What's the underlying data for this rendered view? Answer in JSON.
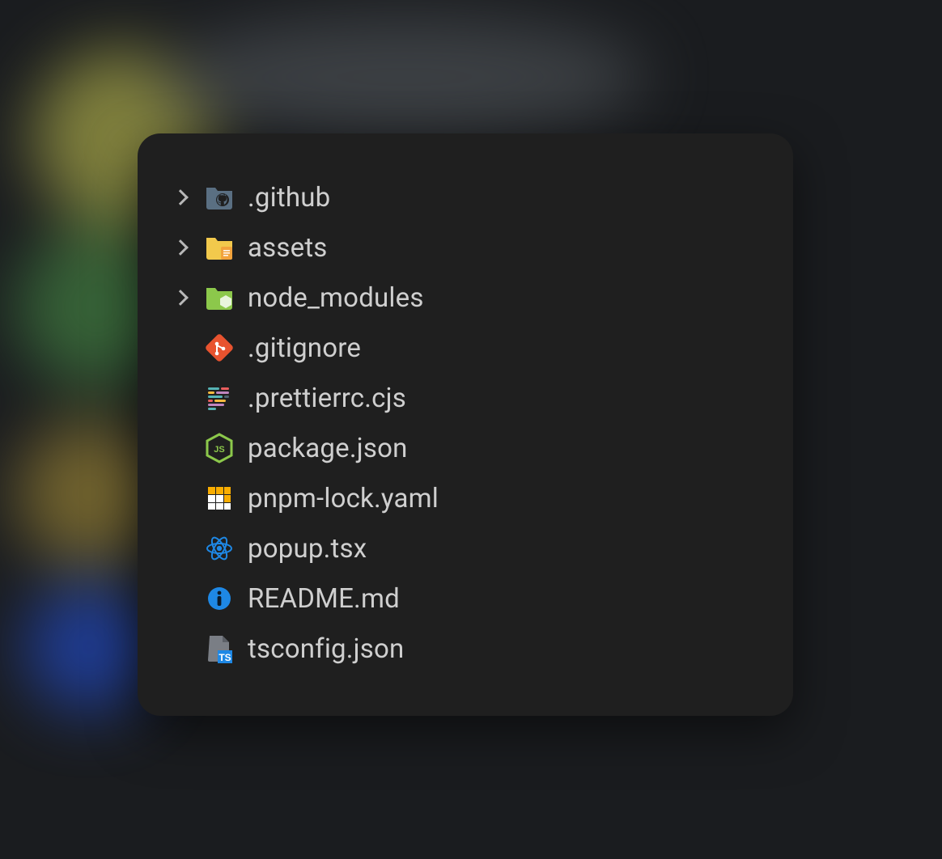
{
  "tree": {
    "items": [
      {
        "type": "folder",
        "icon": "github-folder-icon",
        "label": ".github"
      },
      {
        "type": "folder",
        "icon": "assets-folder-icon",
        "label": "assets"
      },
      {
        "type": "folder",
        "icon": "node-modules-folder-icon",
        "label": "node_modules"
      },
      {
        "type": "file",
        "icon": "git-icon",
        "label": ".gitignore"
      },
      {
        "type": "file",
        "icon": "prettier-icon",
        "label": ".prettierrc.cjs"
      },
      {
        "type": "file",
        "icon": "nodejs-icon",
        "label": "package.json"
      },
      {
        "type": "file",
        "icon": "pnpm-icon",
        "label": "pnpm-lock.yaml"
      },
      {
        "type": "file",
        "icon": "react-icon",
        "label": "popup.tsx"
      },
      {
        "type": "file",
        "icon": "info-icon",
        "label": "README.md"
      },
      {
        "type": "file",
        "icon": "tsconfig-icon",
        "label": "tsconfig.json"
      }
    ]
  },
  "colors": {
    "panel": "#1f1f1f",
    "text": "#cfcfcf",
    "chevron": "#b8b8b8"
  }
}
